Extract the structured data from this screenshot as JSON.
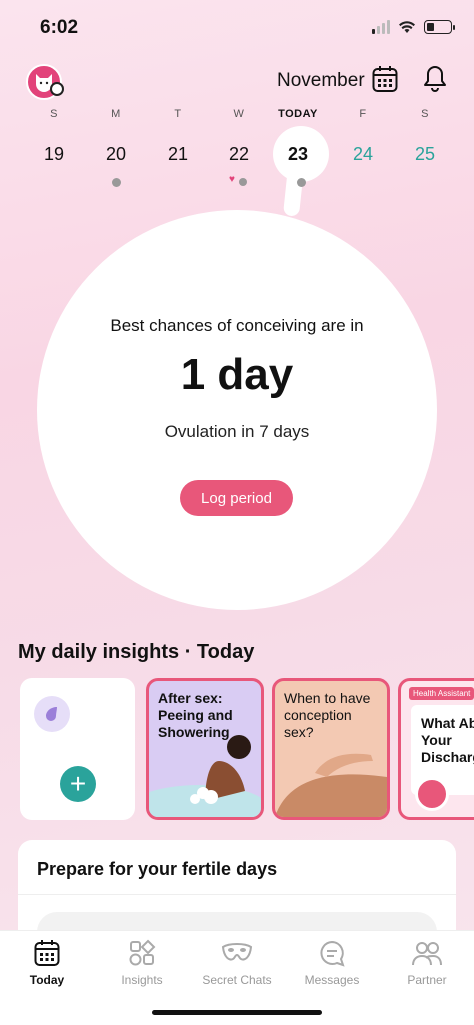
{
  "status_bar": {
    "time": "6:02"
  },
  "header": {
    "month": "November"
  },
  "week": [
    {
      "letter": "S",
      "num": "19"
    },
    {
      "letter": "M",
      "num": "20"
    },
    {
      "letter": "T",
      "num": "21"
    },
    {
      "letter": "W",
      "num": "22"
    },
    {
      "letter": "TODAY",
      "num": "23"
    },
    {
      "letter": "F",
      "num": "24"
    },
    {
      "letter": "S",
      "num": "25"
    }
  ],
  "prediction": {
    "headline": "Best chances of conceiving are in",
    "value": "1 day",
    "ovulation": "Ovulation in 7 days",
    "log_button": "Log period"
  },
  "insights": {
    "title": "My daily insights · Today",
    "stories": [
      {
        "title": "After sex: Peeing and Showering"
      },
      {
        "title": "When to have conception sex?"
      },
      {
        "tag": "Health Assistant",
        "title": "What About Your Discharge"
      }
    ]
  },
  "prepare": {
    "title": "Prepare for your fertile days"
  },
  "tabs": [
    {
      "label": "Today"
    },
    {
      "label": "Insights"
    },
    {
      "label": "Secret Chats"
    },
    {
      "label": "Messages"
    },
    {
      "label": "Partner"
    }
  ],
  "colors": {
    "accent": "#e8577a",
    "teal": "#2aa39b"
  }
}
